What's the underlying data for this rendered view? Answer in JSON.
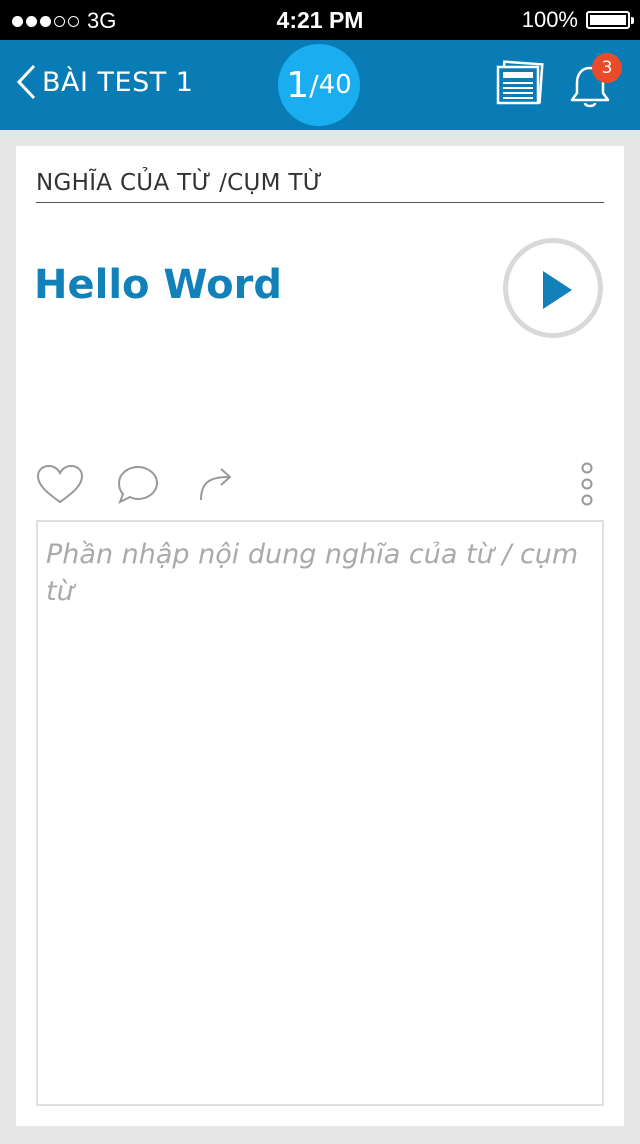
{
  "status_bar": {
    "carrier": "3G",
    "time": "4:21 PM",
    "battery": "100%"
  },
  "header": {
    "title": "BÀI TEST 1",
    "counter_current": "1",
    "counter_separator": "/",
    "counter_total": "40",
    "notification_count": "3",
    "accent_color": "#0a7cb5"
  },
  "card": {
    "section_title": "NGHĨA CỦA TỪ /CỤM TỪ",
    "word": "Hello Word",
    "input_placeholder": "Phần nhập nội dung nghĩa của từ / cụm từ"
  },
  "icons": [
    "back-chevron-icon",
    "news-icon",
    "bell-icon",
    "play-icon",
    "heart-icon",
    "comment-icon",
    "share-icon",
    "more-icon"
  ]
}
